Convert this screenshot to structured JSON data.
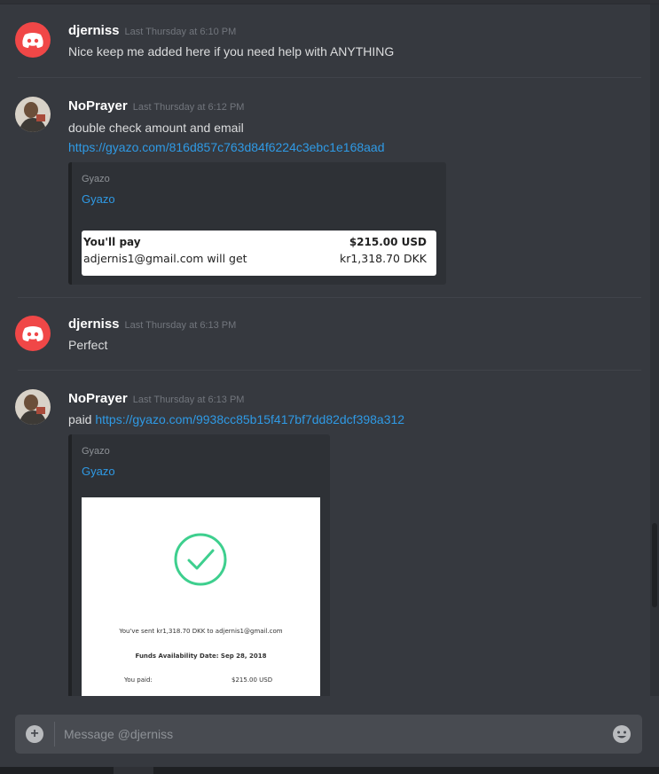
{
  "messages": [
    {
      "author": "djerniss",
      "timestamp": "Last Thursday at 6:10 PM",
      "avatar_icon": "discord-logo-icon",
      "lines": [
        "Nice keep me added here if you need help with ANYTHING"
      ]
    },
    {
      "author": "NoPrayer",
      "timestamp": "Last Thursday at 6:12 PM",
      "avatar_icon": "user-photo",
      "lines": [
        "double check amount and email"
      ],
      "link": "https://gyazo.com/816d857c763d84f6224c3ebc1e168aad",
      "embed": {
        "provider": "Gyazo",
        "title": "Gyazo",
        "image": {
          "row1_label": "You'll pay",
          "row1_value": "$215.00 USD",
          "row2_label": "adjernis1@gmail.com will get",
          "row2_value": "kr1,318.70 DKK"
        }
      }
    },
    {
      "author": "djerniss",
      "timestamp": "Last Thursday at 6:13 PM",
      "avatar_icon": "discord-logo-icon",
      "lines": [
        "Perfect"
      ]
    },
    {
      "author": "NoPrayer",
      "timestamp": "Last Thursday at 6:13 PM",
      "avatar_icon": "user-photo",
      "prefix": "paid",
      "link": "https://gyazo.com/9938cc85b15f417bf7dd82dcf398a312",
      "embed": {
        "provider": "Gyazo",
        "title": "Gyazo",
        "image": {
          "sent_text": "You've sent kr1,318.70 DKK to adjernis1@gmail.com",
          "availability": "Funds Availability Date: Sep 28, 2018",
          "paid_label": "You paid:",
          "paid_value": "$215.00 USD"
        }
      }
    }
  ],
  "composer": {
    "placeholder": "Message @djerniss",
    "attach_icon": "plus-icon",
    "emoji_icon": "emoji-icon"
  },
  "colors": {
    "background": "#36393f",
    "link": "#2f9ae5",
    "discord_red": "#f04747",
    "success_green": "#3ecf8e"
  }
}
